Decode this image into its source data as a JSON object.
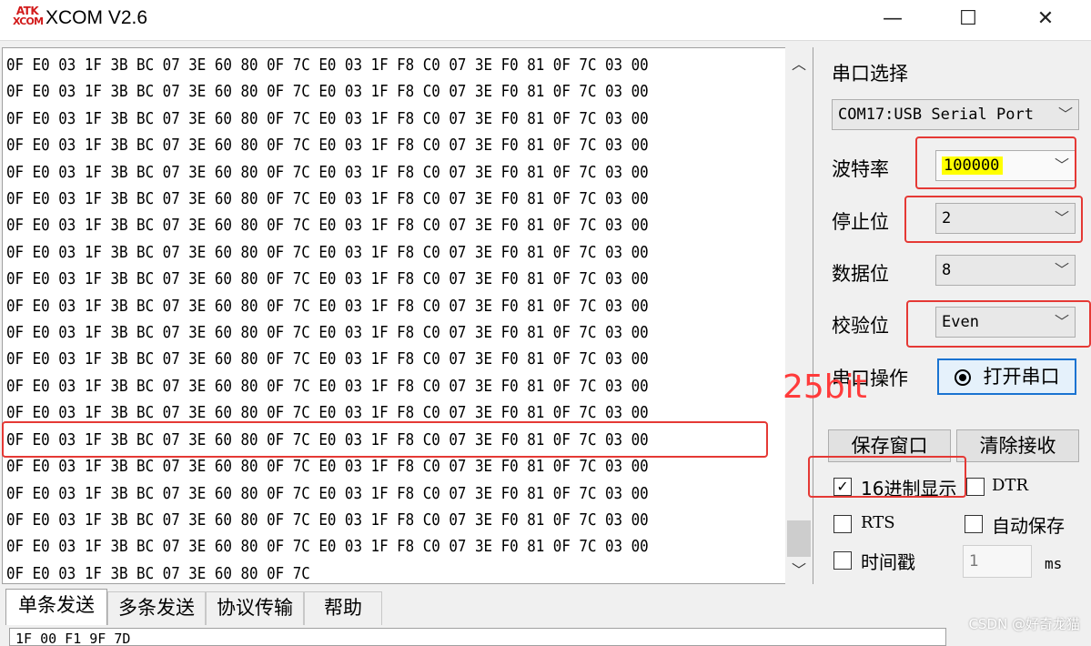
{
  "window": {
    "logo_top": "ATK",
    "logo_bottom": "XCOM",
    "title": "XCOM V2.6",
    "minimize_glyph": "—",
    "maximize_glyph": "☐",
    "close_glyph": "✕"
  },
  "receive": {
    "lines": [
      "0F E0 03 1F 3B BC 07 3E 60 80 0F 7C E0 03 1F F8 C0 07 3E F0 81 0F 7C 03 00",
      "0F E0 03 1F 3B BC 07 3E 60 80 0F 7C E0 03 1F F8 C0 07 3E F0 81 0F 7C 03 00",
      "0F E0 03 1F 3B BC 07 3E 60 80 0F 7C E0 03 1F F8 C0 07 3E F0 81 0F 7C 03 00",
      "0F E0 03 1F 3B BC 07 3E 60 80 0F 7C E0 03 1F F8 C0 07 3E F0 81 0F 7C 03 00",
      "0F E0 03 1F 3B BC 07 3E 60 80 0F 7C E0 03 1F F8 C0 07 3E F0 81 0F 7C 03 00",
      "0F E0 03 1F 3B BC 07 3E 60 80 0F 7C E0 03 1F F8 C0 07 3E F0 81 0F 7C 03 00",
      "0F E0 03 1F 3B BC 07 3E 60 80 0F 7C E0 03 1F F8 C0 07 3E F0 81 0F 7C 03 00",
      "0F E0 03 1F 3B BC 07 3E 60 80 0F 7C E0 03 1F F8 C0 07 3E F0 81 0F 7C 03 00",
      "0F E0 03 1F 3B BC 07 3E 60 80 0F 7C E0 03 1F F8 C0 07 3E F0 81 0F 7C 03 00",
      "0F E0 03 1F 3B BC 07 3E 60 80 0F 7C E0 03 1F F8 C0 07 3E F0 81 0F 7C 03 00",
      "0F E0 03 1F 3B BC 07 3E 60 80 0F 7C E0 03 1F F8 C0 07 3E F0 81 0F 7C 03 00",
      "0F E0 03 1F 3B BC 07 3E 60 80 0F 7C E0 03 1F F8 C0 07 3E F0 81 0F 7C 03 00",
      "0F E0 03 1F 3B BC 07 3E 60 80 0F 7C E0 03 1F F8 C0 07 3E F0 81 0F 7C 03 00",
      "0F E0 03 1F 3B BC 07 3E 60 80 0F 7C E0 03 1F F8 C0 07 3E F0 81 0F 7C 03 00",
      "0F E0 03 1F 3B BC 07 3E 60 80 0F 7C E0 03 1F F8 C0 07 3E F0 81 0F 7C 03 00",
      "0F E0 03 1F 3B BC 07 3E 60 80 0F 7C E0 03 1F F8 C0 07 3E F0 81 0F 7C 03 00",
      "0F E0 03 1F 3B BC 07 3E 60 80 0F 7C E0 03 1F F8 C0 07 3E F0 81 0F 7C 03 00",
      "0F E0 03 1F 3B BC 07 3E 60 80 0F 7C E0 03 1F F8 C0 07 3E F0 81 0F 7C 03 00",
      "0F E0 03 1F 3B BC 07 3E 60 80 0F 7C E0 03 1F F8 C0 07 3E F0 81 0F 7C 03 00",
      "0F E0 03 1F 3B BC 07 3E 60 80 0F 7C"
    ],
    "highlighted_line_index": 14
  },
  "panel": {
    "port_section_label": "串口选择",
    "port_value": "COM17:USB Serial Port",
    "baud_label": "波特率",
    "baud_value": "100000",
    "stop_label": "停止位",
    "stop_value": "2",
    "data_label": "数据位",
    "data_value": "8",
    "parity_label": "校验位",
    "parity_value": "Even",
    "op_label": "串口操作",
    "open_button": "打开串口",
    "save_button": "保存窗口",
    "clear_button": "清除接收",
    "hex_display_label": "16进制显示",
    "hex_display_checked": true,
    "dtr_label": "DTR",
    "dtr_checked": false,
    "rts_label": "RTS",
    "rts_checked": false,
    "autosave_label": "自动保存",
    "autosave_checked": false,
    "timestamp_label": "时间戳",
    "timestamp_checked": false,
    "timestamp_value": "1",
    "timestamp_unit": "ms"
  },
  "tabs": [
    {
      "label": "单条发送",
      "active": true
    },
    {
      "label": "多条发送",
      "active": false
    },
    {
      "label": "协议传输",
      "active": false
    },
    {
      "label": "帮助",
      "active": false
    }
  ],
  "send_text": "1F 00 F1 9F 7D",
  "annotation": "25bit",
  "watermark": "CSDN @好奇龙猫",
  "colors": {
    "annotation_red": "#e53935",
    "baud_highlight": "#ffff00",
    "primary_border": "#1a73d1"
  }
}
